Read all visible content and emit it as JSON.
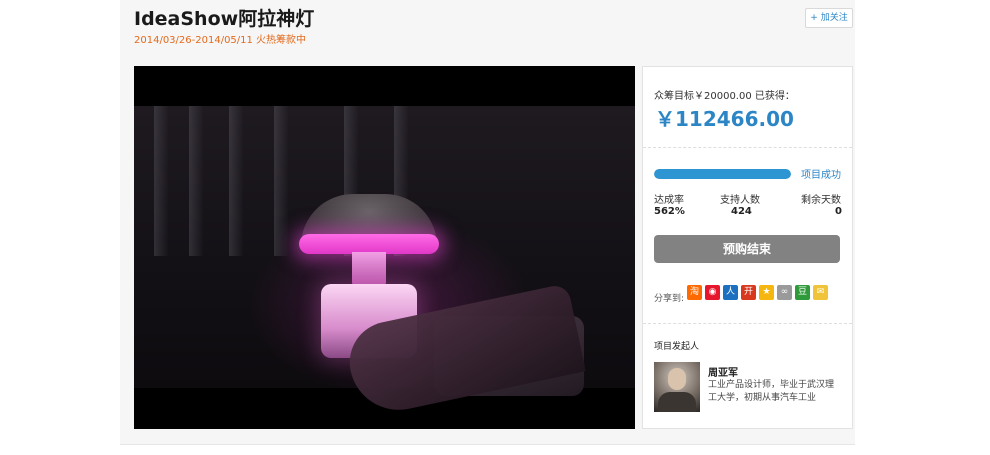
{
  "header": {
    "title": "IdeaShow阿拉神灯",
    "subtitle": "2014/03/26-2014/05/11  火热筹款中",
    "follow_label": "+ 加关注"
  },
  "funding": {
    "goal_text": "众筹目标￥20000.00  已获得：",
    "raised": "￥112466.00",
    "progress_percent": 100,
    "status": "项目成功",
    "stats": [
      {
        "label": "达成率",
        "value": "562%"
      },
      {
        "label": "支持人数",
        "value": "424"
      },
      {
        "label": "剩余天数",
        "value": "0"
      }
    ],
    "end_button": "预购结束"
  },
  "share": {
    "label": "分享到:",
    "icons": [
      {
        "name": "taobao-icon",
        "glyph": "淘",
        "color": "#ff6a00"
      },
      {
        "name": "weibo-icon",
        "glyph": "◉",
        "color": "#e6162d"
      },
      {
        "name": "renren-icon",
        "glyph": "人",
        "color": "#1d6fbf"
      },
      {
        "name": "kaixin-icon",
        "glyph": "开",
        "color": "#d7381e"
      },
      {
        "name": "qzone-icon",
        "glyph": "★",
        "color": "#f5b70f"
      },
      {
        "name": "link-icon",
        "glyph": "∞",
        "color": "#9a9a9a"
      },
      {
        "name": "douban-icon",
        "glyph": "豆",
        "color": "#2f9a3a"
      },
      {
        "name": "email-icon",
        "glyph": "✉",
        "color": "#f0c43a"
      }
    ]
  },
  "creator": {
    "section_title": "项目发起人",
    "name": "周亚军",
    "bio": "工业产品设计师，毕业于武汉理工大学，初期从事汽车工业"
  }
}
